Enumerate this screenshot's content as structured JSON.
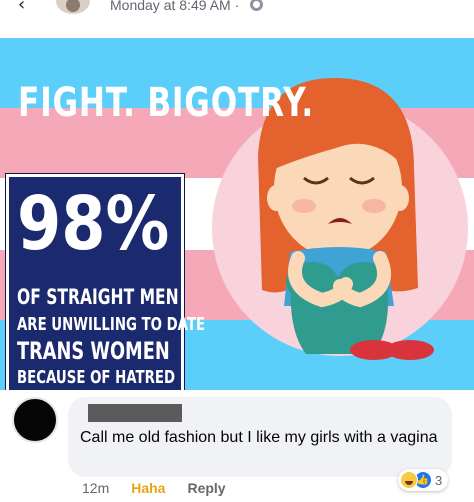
{
  "post": {
    "timestamp": "Monday at 8:49 AM · "
  },
  "meme": {
    "title": "FIGHT. BIGOTRY.",
    "stat_number": "98%",
    "stat_lines": [
      "OF STRAIGHT MEN",
      "ARE UNWILLING TO DATE",
      "TRANS WOMEN",
      "BECAUSE OF HATRED"
    ],
    "colors": {
      "flag_blue": "#5bcefa",
      "flag_pink": "#f5a9b8",
      "flag_white": "#ffffff",
      "box_navy": "#1b2a6e"
    }
  },
  "comment": {
    "text": "Call me old fashion but I like my girls with a vagina",
    "time": "12m",
    "reaction_label": "Haha",
    "reply_label": "Reply",
    "reaction_count": "3",
    "reaction_icons": [
      "haha-emoji",
      "like-thumb"
    ]
  }
}
